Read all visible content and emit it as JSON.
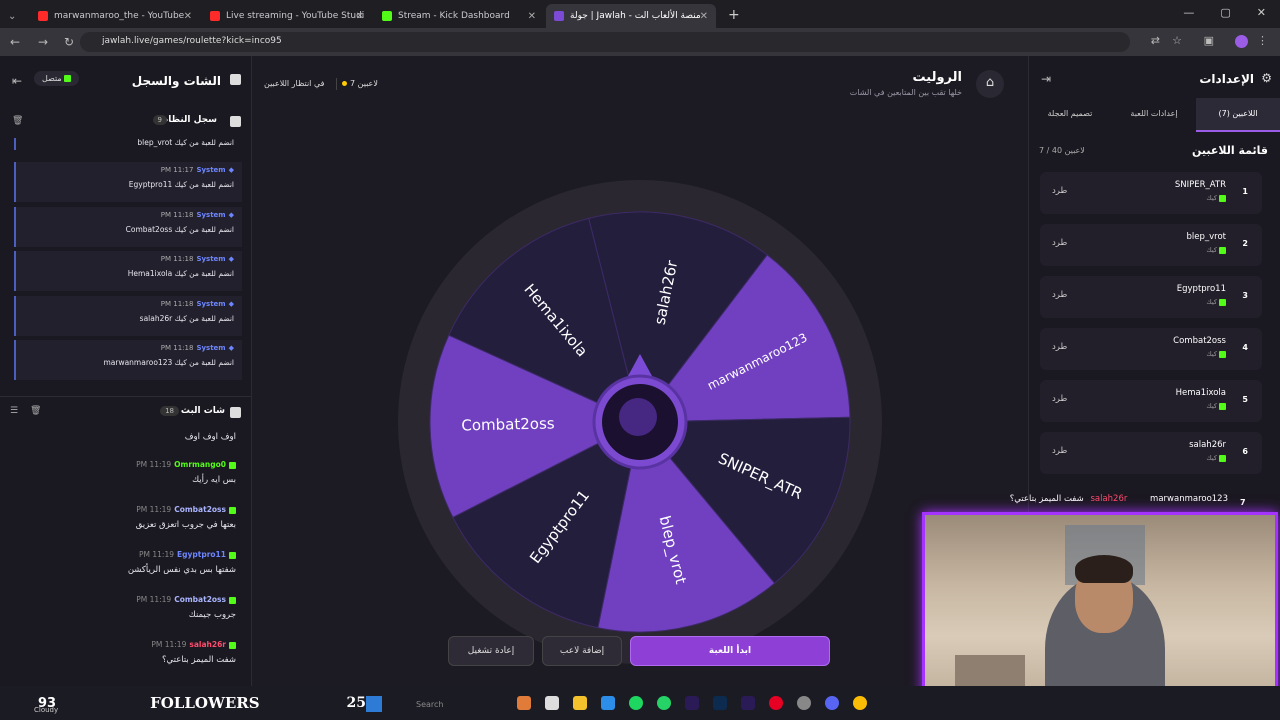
{
  "tabs": [
    {
      "title": "marwanmaroo_the - YouTube",
      "color": "#ff2b2b"
    },
    {
      "title": "Live streaming - YouTube Studi",
      "color": "#ff2b2b"
    },
    {
      "title": "Stream - Kick Dashboard",
      "color": "#53fc18"
    },
    {
      "title": "جولة | Jawlah - منصة الألعاب الت",
      "color": "#7b4bd6"
    }
  ],
  "window_controls": [
    "—",
    "▢",
    "✕"
  ],
  "url": "jawlah.live/games/roulette?kick=inco95",
  "left_panel": {
    "title": "الشات والسجل",
    "status": "متصل",
    "system_log": {
      "title": "سجل النظام",
      "count": "9"
    },
    "first_partial": "blep_vrot انضم للعبة من كيك",
    "system_messages": [
      {
        "user": "System",
        "time": "PM 11:17",
        "text": "Egyptpro11 انضم للعبة من كيك"
      },
      {
        "user": "System",
        "time": "PM 11:18",
        "text": "Combat2oss انضم للعبة من كيك"
      },
      {
        "user": "System",
        "time": "PM 11:18",
        "text": "Hema1ixola انضم للعبة من كيك"
      },
      {
        "user": "System",
        "time": "PM 11:18",
        "text": "salah26r انضم للعبة من كيك"
      },
      {
        "user": "System",
        "time": "PM 11:18",
        "text": "marwanmaroo123 انضم للعبة من كيك"
      }
    ],
    "chat_title": "شات البث",
    "chat_count": "18",
    "chat_first": "اوف اوف اوف",
    "chat": [
      {
        "user": "Omrmango0",
        "time": "PM 11:19",
        "text": "بس ايه رأيك",
        "color": "#53fc18"
      },
      {
        "user": "Combat2oss",
        "time": "PM 11:19",
        "text": "بعتها في جروب اتعزق تعزيق",
        "color": "#a9b4ff"
      },
      {
        "user": "Egyptpro11",
        "time": "PM 11:19",
        "text": "شفتها بس بدي نفس الريأكشن",
        "color": "#6d86ff"
      },
      {
        "user": "Combat2oss",
        "time": "PM 11:19",
        "text": "جروب جيمنك",
        "color": "#a9b4ff"
      },
      {
        "user": "salah26r",
        "time": "PM 11:19",
        "text": "شفت الميمز بتاعتي؟",
        "color": "#ff4d6d"
      }
    ]
  },
  "center": {
    "title": "الروليت",
    "subtitle": "خلها تقب بين المتابعين في الشات",
    "players_pill": "7 لاعبين",
    "waiting_pill": "في انتظار اللاعبين",
    "wheel": [
      "salah26r",
      "marwanmaroo123",
      "SNIPER_ATR",
      "blep_vrot",
      "Egyptpro11",
      "Combat2oss",
      "Hema1ixola"
    ],
    "buttons": {
      "start": "ابدأ اللعبة",
      "add": "إضافة لاعب",
      "restart": "إعادة تشغيل"
    }
  },
  "right_panel": {
    "title": "الإعدادات",
    "tabs": [
      "اللاعبين (7)",
      "إعدادات اللعبة",
      "تصميم العجلة"
    ],
    "list_title": "قائمة اللاعبين",
    "list_count": "7 / 40 لاعبين",
    "kick_label": "كيك",
    "kick_action": "طرد",
    "players": [
      {
        "num": "1",
        "name": "SNIPER_ATR"
      },
      {
        "num": "2",
        "name": "blep_vrot"
      },
      {
        "num": "3",
        "name": "Egyptpro11"
      },
      {
        "num": "4",
        "name": "Combat2oss"
      },
      {
        "num": "5",
        "name": "Hema1ixola"
      },
      {
        "num": "6",
        "name": "salah26r"
      }
    ],
    "player7_num": "7"
  },
  "stream_overlay": {
    "user": "marwanmaroo123",
    "text": "شفت الميمز بتاعتي؟",
    "other": "salah26r"
  },
  "taskbar": {
    "temp": "93",
    "weather": "Cloudy",
    "followers_label": "FOLLOWERS",
    "followers": "250",
    "search": "Search"
  }
}
